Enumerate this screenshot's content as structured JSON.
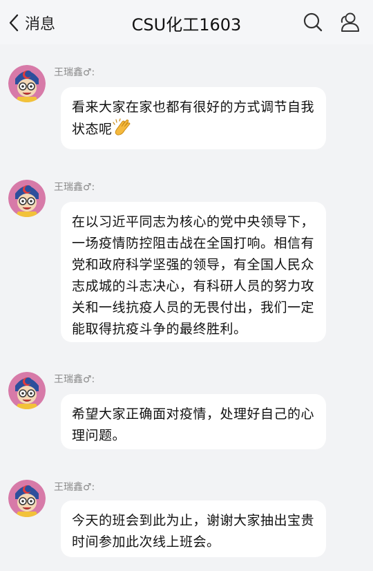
{
  "header": {
    "back_label": "消息",
    "title": "CSU化工1603"
  },
  "messages": [
    {
      "sender": "王瑞鑫♂:",
      "text": "看来大家在家也都有很好的方式调节自我状态呢",
      "emoji": "clapping-hands"
    },
    {
      "sender": "王瑞鑫♂:",
      "text": "在以习近平同志为核心的党中央领导下，一场疫情防控阻击战在全国打响。相信有党和政府科学坚强的领导，有全国人民众志成城的斗志决心，有科研人员的努力攻关和一线抗疫人员的无畏付出，我们一定能取得抗疫斗争的最终胜利。"
    },
    {
      "sender": "王瑞鑫♂:",
      "text": "希望大家正确面对疫情，处理好自己的心理问题。"
    },
    {
      "sender": "王瑞鑫♂:",
      "text": "今天的班会到此为止，谢谢大家抽出宝贵时间参加此次线上班会。"
    }
  ],
  "colors": {
    "background": "#f2f3f5",
    "bubble": "#ffffff",
    "sender_text": "#8a8a8a"
  }
}
